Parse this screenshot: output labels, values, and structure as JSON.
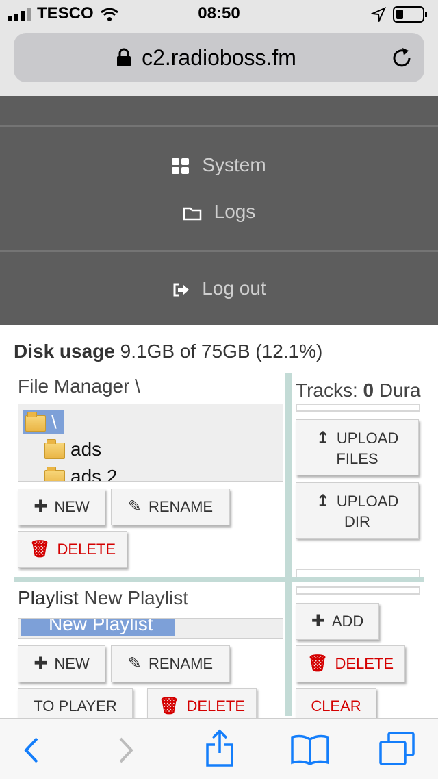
{
  "status_bar": {
    "carrier": "TESCO",
    "time": "08:50"
  },
  "browser": {
    "url": "c2.radioboss.fm"
  },
  "menu": {
    "items": [
      {
        "label": "System",
        "icon": "grid-icon"
      },
      {
        "label": "Logs",
        "icon": "folder-icon"
      },
      {
        "label": "Log out",
        "icon": "sign-out-icon"
      }
    ]
  },
  "disk": {
    "label": "Disk usage",
    "value": "9.1GB of 75GB (12.1%)"
  },
  "file_manager": {
    "title": "File Manager \\",
    "tree": [
      {
        "name": "\\",
        "selected": true
      },
      {
        "name": "ads",
        "selected": false
      },
      {
        "name": "ads 2",
        "selected": false
      }
    ],
    "new_label": "NEW",
    "rename_label": "RENAME",
    "delete_label": "DELETE"
  },
  "tracks": {
    "label": "Tracks:",
    "count": "0",
    "duration_label": "Dura",
    "upload_files_line1": "UPLOAD",
    "upload_files_line2": "FILES",
    "upload_dir_line1": "UPLOAD",
    "upload_dir_line2": "DIR"
  },
  "playlist": {
    "title_bold": "Playlist",
    "title_name": "New Playlist",
    "selected_item": "New Playlist",
    "new_label": "NEW",
    "rename_label": "RENAME",
    "to_player_label": "TO PLAYER",
    "delete_label": "DELETE",
    "add_label": "ADD",
    "delete2_label": "DELETE",
    "clear_label": "CLEAR"
  },
  "colors": {
    "menu_bg": "#5d5d5d",
    "accent_blue": "#147efb",
    "danger": "#d40000",
    "separator": "#c3dbd6"
  }
}
